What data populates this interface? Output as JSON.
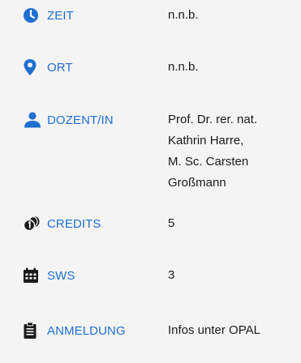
{
  "colors": {
    "accent": "#1f6fd1",
    "background": "#f4f4f4",
    "text": "#1a1a1a"
  },
  "rows": [
    {
      "icon": "clock-icon",
      "label": "ZEIT",
      "value": [
        "n.n.b."
      ]
    },
    {
      "icon": "map-pin-icon",
      "label": "ORT",
      "value": [
        "n.n.b."
      ]
    },
    {
      "icon": "person-icon",
      "label": "DOZENT/IN",
      "value": [
        "Prof. Dr. rer. nat.",
        "Kathrin Harre,",
        "M. Sc. Carsten",
        "Großmann"
      ]
    },
    {
      "icon": "coins-icon",
      "label": "CREDITS",
      "value": [
        "5"
      ]
    },
    {
      "icon": "calendar-icon",
      "label": "SWS",
      "value": [
        "3"
      ]
    },
    {
      "icon": "clipboard-icon",
      "label": "ANMELDUNG",
      "value": [
        "Infos unter OPAL"
      ]
    }
  ]
}
